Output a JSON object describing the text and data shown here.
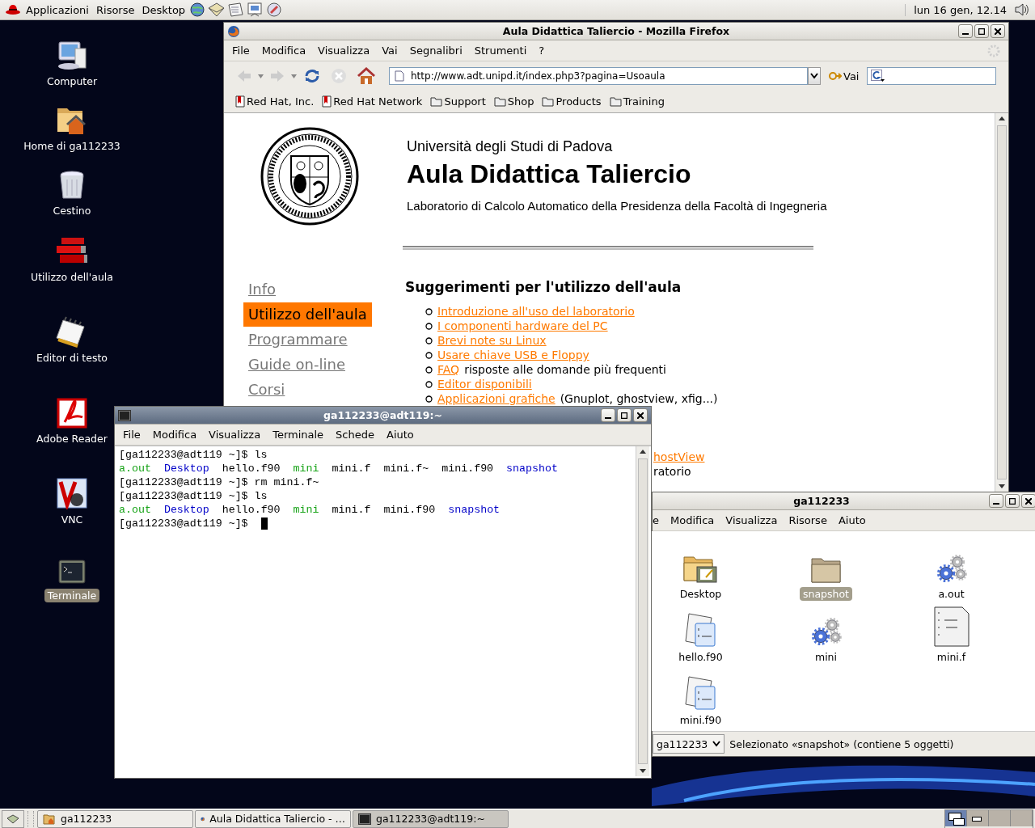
{
  "top_panel": {
    "menus": [
      "Applicazioni",
      "Risorse",
      "Desktop"
    ],
    "clock": "lun 16 gen, 12.14"
  },
  "desktop_icons": [
    {
      "label": "Computer",
      "kind": "computer",
      "selected": false
    },
    {
      "label": "Home di ga112233",
      "kind": "home",
      "selected": false
    },
    {
      "label": "Cestino",
      "kind": "trash",
      "selected": false
    },
    {
      "label": "Utilizzo dell'aula",
      "kind": "books",
      "selected": false
    },
    {
      "label": "Editor di testo",
      "kind": "editor",
      "selected": false
    },
    {
      "label": "Adobe Reader",
      "kind": "pdf",
      "selected": false
    },
    {
      "label": "VNC",
      "kind": "vnc",
      "selected": false
    },
    {
      "label": "Terminale",
      "kind": "terminal",
      "selected": true
    }
  ],
  "browser": {
    "title": "Aula Didattica Taliercio - Mozilla Firefox",
    "active": false,
    "menu": [
      "File",
      "Modifica",
      "Visualizza",
      "Vai",
      "Segnalibri",
      "Strumenti",
      "?"
    ],
    "url": "http://www.adt.unipd.it/index.php3?pagina=Usoaula",
    "go_label": "Vai",
    "bookmarks": [
      {
        "label": "Red Hat, Inc.",
        "kind": "page"
      },
      {
        "label": "Red Hat Network",
        "kind": "page"
      },
      {
        "label": "Support",
        "kind": "folder"
      },
      {
        "label": "Shop",
        "kind": "folder"
      },
      {
        "label": "Products",
        "kind": "folder"
      },
      {
        "label": "Training",
        "kind": "folder"
      }
    ],
    "page": {
      "university": "Università degli Studi di Padova",
      "heading": "Aula Didattica Taliercio",
      "subtitle": "Laboratorio di Calcolo Automatico della Presidenza della Facoltà di Ingegneria",
      "nav": [
        {
          "label": "Info",
          "selected": false
        },
        {
          "label": "Utilizzo dell'aula",
          "selected": true
        },
        {
          "label": "Programmare",
          "selected": false
        },
        {
          "label": "Guide on-line",
          "selected": false
        },
        {
          "label": "Corsi",
          "selected": false
        }
      ],
      "section_title": "Suggerimenti per l'utilizzo dell'aula",
      "items": [
        {
          "link": "Introduzione all'uso del laboratorio"
        },
        {
          "link": "I componenti hardware del PC"
        },
        {
          "link": "Brevi note su Linux"
        },
        {
          "link": "Usare chiave USB e Floppy"
        },
        {
          "link": "FAQ",
          "text": "risposte alle domande più frequenti"
        },
        {
          "link": "Editor disponibili"
        },
        {
          "link": "Applicazioni grafiche",
          "text": "(Gnuplot, ghostview, xfig...)"
        }
      ],
      "covered_fragments": [
        {
          "text": "hostView",
          "kind": "link"
        },
        {
          "text": "ratorio",
          "kind": "text"
        }
      ]
    }
  },
  "terminal": {
    "title": "ga112233@adt119:~",
    "active": true,
    "menu": [
      "File",
      "Modifica",
      "Visualizza",
      "Terminale",
      "Schede",
      "Aiuto"
    ],
    "lines": [
      {
        "kind": "command",
        "text": "[ga112233@adt119 ~]$ ls"
      },
      {
        "kind": "listing",
        "files": [
          {
            "name": "a.out",
            "kind": "exec"
          },
          {
            "name": "Desktop",
            "kind": "dir"
          },
          {
            "name": "hello.f90",
            "kind": "file"
          },
          {
            "name": "mini",
            "kind": "exec"
          },
          {
            "name": "mini.f",
            "kind": "file"
          },
          {
            "name": "mini.f~",
            "kind": "file"
          },
          {
            "name": "mini.f90",
            "kind": "file"
          },
          {
            "name": "snapshot",
            "kind": "dir"
          }
        ]
      },
      {
        "kind": "command",
        "text": "[ga112233@adt119 ~]$ rm mini.f~"
      },
      {
        "kind": "command",
        "text": "[ga112233@adt119 ~]$ ls"
      },
      {
        "kind": "listing",
        "files": [
          {
            "name": "a.out",
            "kind": "exec"
          },
          {
            "name": "Desktop",
            "kind": "dir"
          },
          {
            "name": "hello.f90",
            "kind": "file"
          },
          {
            "name": "mini",
            "kind": "exec"
          },
          {
            "name": "mini.f",
            "kind": "file"
          },
          {
            "name": "mini.f90",
            "kind": "file"
          },
          {
            "name": "snapshot",
            "kind": "dir"
          }
        ]
      },
      {
        "kind": "prompt",
        "text": "[ga112233@adt119 ~]$"
      }
    ]
  },
  "file_manager": {
    "title": "ga112233",
    "active": false,
    "menu": [
      "e",
      "Modifica",
      "Visualizza",
      "Risorse",
      "Aiuto"
    ],
    "items": [
      {
        "name": "Desktop",
        "kind": "desktop-folder",
        "selected": false
      },
      {
        "name": "snapshot",
        "kind": "folder",
        "selected": true
      },
      {
        "name": "a.out",
        "kind": "exec",
        "selected": false
      },
      {
        "name": "hello.f90",
        "kind": "source",
        "selected": false
      },
      {
        "name": "mini",
        "kind": "exec",
        "selected": false
      },
      {
        "name": "mini.f",
        "kind": "text",
        "selected": false
      },
      {
        "name": "mini.f90",
        "kind": "source",
        "selected": false
      }
    ],
    "location": "ga112233",
    "status": "Selezionato «snapshot» (contiene 5 oggetti)"
  },
  "taskbar": [
    {
      "label": "ga112233",
      "kind": "folder",
      "selected": false
    },
    {
      "label": "Aula Didattica Taliercio - …",
      "kind": "browser",
      "selected": false
    },
    {
      "label": "ga112233@adt119:~",
      "kind": "terminal",
      "selected": true
    }
  ]
}
